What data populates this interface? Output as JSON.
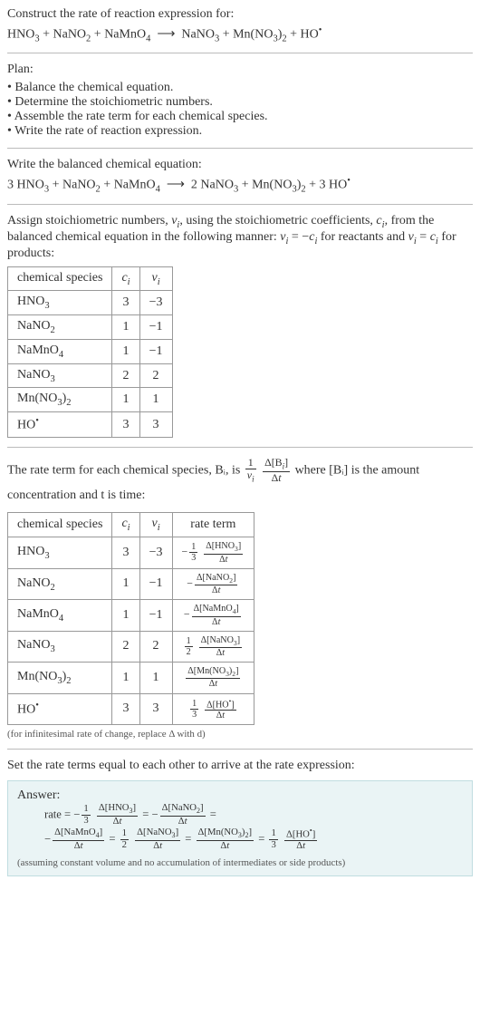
{
  "header": {
    "title": "Construct the rate of reaction expression for:",
    "equation": "HNO₃ + NaNO₂ + NaMnO₄  ⟶  NaNO₃ + Mn(NO₃)₂ + HO•"
  },
  "plan": {
    "title": "Plan:",
    "items": [
      "Balance the chemical equation.",
      "Determine the stoichiometric numbers.",
      "Assemble the rate term for each chemical species.",
      "Write the rate of reaction expression."
    ]
  },
  "balanced": {
    "title": "Write the balanced chemical equation:",
    "equation": "3 HNO₃ + NaNO₂ + NaMnO₄  ⟶  2 NaNO₃ + Mn(NO₃)₂ + 3 HO•"
  },
  "stoich_intro": "Assign stoichiometric numbers, νᵢ, using the stoichiometric coefficients, cᵢ, from the balanced chemical equation in the following manner: νᵢ = −cᵢ for reactants and νᵢ = cᵢ for products:",
  "stoich_table": {
    "headers": {
      "species": "chemical species",
      "c": "cᵢ",
      "nu": "νᵢ"
    },
    "rows": [
      {
        "species": "HNO₃",
        "c": "3",
        "nu": "−3"
      },
      {
        "species": "NaNO₂",
        "c": "1",
        "nu": "−1"
      },
      {
        "species": "NaMnO₄",
        "c": "1",
        "nu": "−1"
      },
      {
        "species": "NaNO₃",
        "c": "2",
        "nu": "2"
      },
      {
        "species": "Mn(NO₃)₂",
        "c": "1",
        "nu": "1"
      },
      {
        "species": "HO•",
        "c": "3",
        "nu": "3"
      }
    ]
  },
  "rate_intro_a": "The rate term for each chemical species, Bᵢ, is ",
  "rate_intro_b": " where [Bᵢ] is the amount concentration and t is time:",
  "rate_table": {
    "headers": {
      "species": "chemical species",
      "c": "cᵢ",
      "nu": "νᵢ",
      "term": "rate term"
    },
    "rows": [
      {
        "species": "HNO₃",
        "c": "3",
        "nu": "−3",
        "coef": "−⅓",
        "dnum": "Δ[HNO₃]"
      },
      {
        "species": "NaNO₂",
        "c": "1",
        "nu": "−1",
        "coef": "−",
        "dnum": "Δ[NaNO₂]"
      },
      {
        "species": "NaMnO₄",
        "c": "1",
        "nu": "−1",
        "coef": "−",
        "dnum": "Δ[NaMnO₄]"
      },
      {
        "species": "NaNO₃",
        "c": "2",
        "nu": "2",
        "coef": "½",
        "dnum": "Δ[NaNO₃]"
      },
      {
        "species": "Mn(NO₃)₂",
        "c": "1",
        "nu": "1",
        "coef": "",
        "dnum": "Δ[Mn(NO₃)₂]"
      },
      {
        "species": "HO•",
        "c": "3",
        "nu": "3",
        "coef": "⅓",
        "dnum": "Δ[HO•]"
      }
    ]
  },
  "rate_note": "(for infinitesimal rate of change, replace Δ with d)",
  "set_equal": "Set the rate terms equal to each other to arrive at the rate expression:",
  "answer": {
    "label": "Answer:",
    "line1_prefix": "rate = −",
    "note": "(assuming constant volume and no accumulation of intermediates or side products)"
  },
  "frac_labels": {
    "one": "1",
    "nu": "νᵢ",
    "dBi": "Δ[Bᵢ]",
    "dt": "Δt",
    "three": "3",
    "two": "2"
  }
}
